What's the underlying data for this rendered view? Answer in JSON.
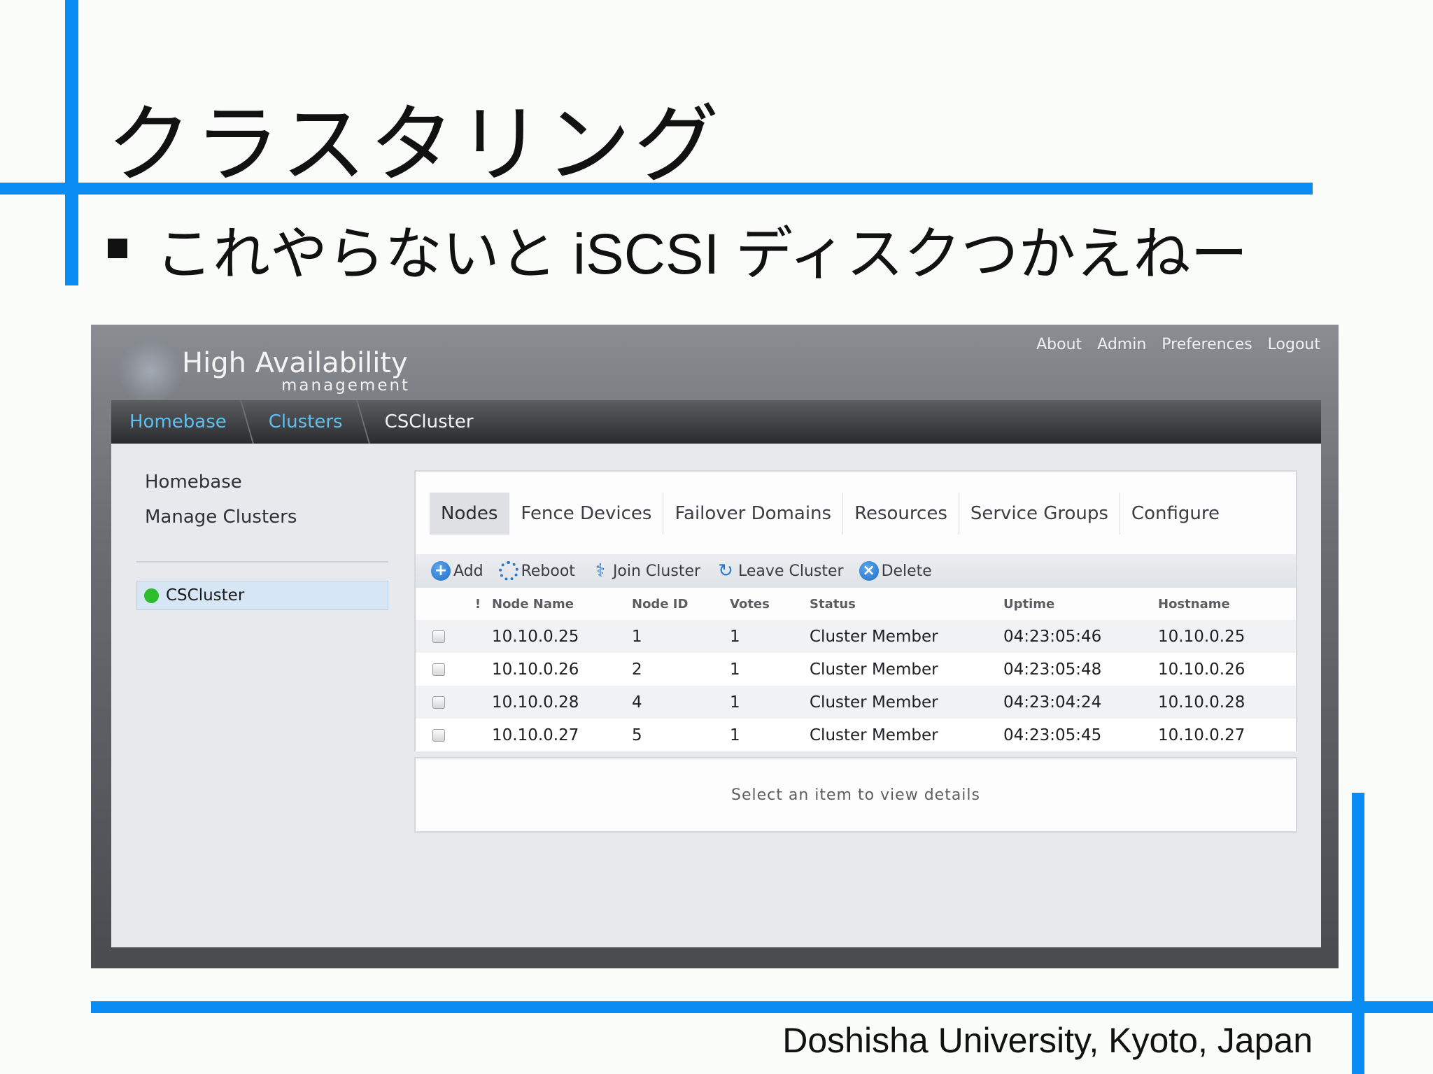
{
  "slide": {
    "title": "クラスタリング",
    "bullet": "これやらないと iSCSI ディスクつかえねー",
    "footer": "Doshisha University, Kyoto, Japan",
    "accent_color": "#0a8cf5"
  },
  "app": {
    "brand_title": "High Availability",
    "brand_subtitle": "management",
    "top_nav": [
      "About",
      "Admin",
      "Preferences",
      "Logout"
    ],
    "breadcrumb": [
      "Homebase",
      "Clusters",
      "CSCluster"
    ],
    "sidebar": {
      "links": [
        "Homebase",
        "Manage Clusters"
      ],
      "cluster": {
        "name": "CSCluster",
        "status_color": "#2bbd2b"
      }
    },
    "tabs": [
      "Nodes",
      "Fence Devices",
      "Failover Domains",
      "Resources",
      "Service Groups",
      "Configure"
    ],
    "active_tab": "Nodes",
    "toolbar": [
      {
        "label": "Add",
        "icon": "plus-icon"
      },
      {
        "label": "Reboot",
        "icon": "reboot-icon"
      },
      {
        "label": "Join Cluster",
        "icon": "link-icon"
      },
      {
        "label": "Leave Cluster",
        "icon": "refresh-icon"
      },
      {
        "label": "Delete",
        "icon": "delete-icon"
      }
    ],
    "table": {
      "headers": [
        "!",
        "Node Name",
        "Node ID",
        "Votes",
        "Status",
        "Uptime",
        "Hostname"
      ],
      "rows": [
        [
          "10.10.0.25",
          "1",
          "1",
          "Cluster Member",
          "04:23:05:46",
          "10.10.0.25"
        ],
        [
          "10.10.0.26",
          "2",
          "1",
          "Cluster Member",
          "04:23:05:48",
          "10.10.0.26"
        ],
        [
          "10.10.0.28",
          "4",
          "1",
          "Cluster Member",
          "04:23:04:24",
          "10.10.0.28"
        ],
        [
          "10.10.0.27",
          "5",
          "1",
          "Cluster Member",
          "04:23:05:45",
          "10.10.0.27"
        ]
      ]
    },
    "details_placeholder": "Select an item to view details"
  }
}
